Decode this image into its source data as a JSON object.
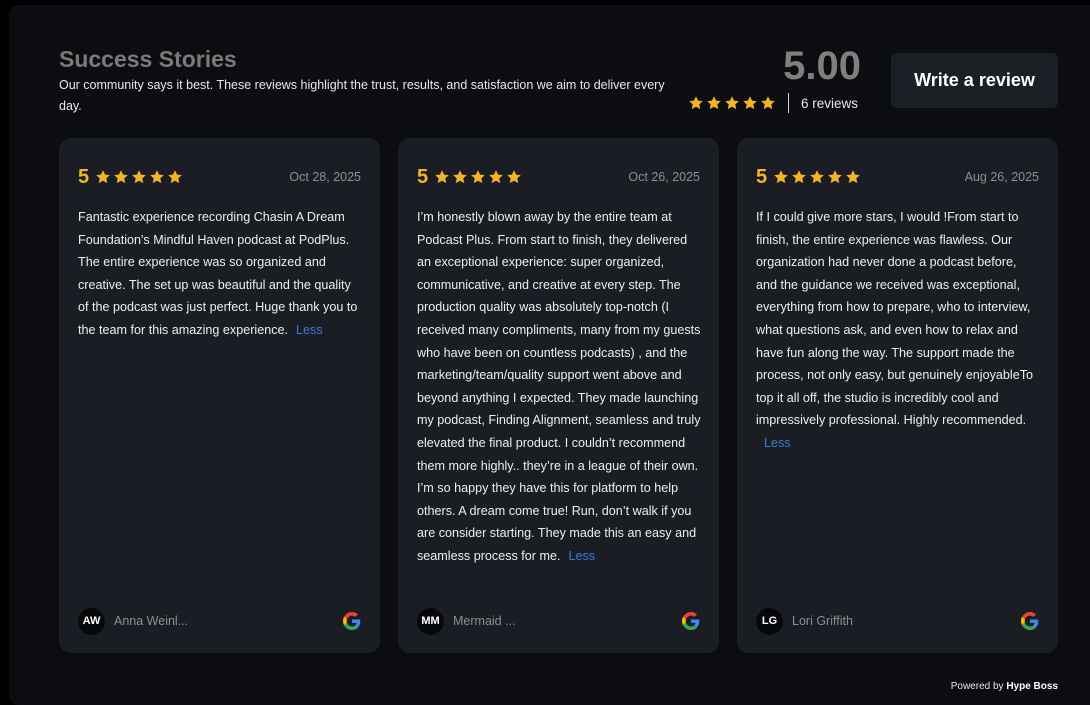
{
  "header": {
    "title": "Success Stories",
    "subtitle": "Our community says it best. These reviews highlight the trust, results, and satisfaction we aim to deliver every day."
  },
  "summary": {
    "score": "5.00",
    "rating": 5,
    "review_count": "6 reviews",
    "write_review_label": "Write a review"
  },
  "colors": {
    "star": "#f5b428",
    "link": "#3a7bd5",
    "card_bg": "#1a1e24"
  },
  "icons": {
    "star": "star-icon",
    "source": "google-icon"
  },
  "reviews": [
    {
      "rating": "5",
      "date": "Oct 28, 2025",
      "text": "Fantastic experience recording Chasin A Dream Foundation's Mindful Haven podcast at PodPlus. The entire experience was so organized and creative. The set up was beautiful and the quality of the podcast was just perfect. Huge thank you to the team for this amazing experience.",
      "less_label": "Less",
      "initials": "AW",
      "author": "Anna Weinl..."
    },
    {
      "rating": "5",
      "date": "Oct 26, 2025",
      "text": "I’m honestly blown away by the entire team at Podcast Plus. From start to finish, they delivered an exceptional experience: super organized, communicative, and creative at every step. The production quality was absolutely top-notch (I received many compliments, many from my guests who have been on countless podcasts) , and the marketing/team/quality support went above and beyond anything I expected. They made launching my podcast, Finding Alignment, seamless and truly elevated the final product. I couldn’t recommend them more highly.. they’re in a league of their own. I’m so happy they have this for platform to help others. A dream come true! Run, don’t walk if you are consider starting. They made this an easy and seamless process for me.",
      "less_label": "Less",
      "initials": "MM",
      "author": "Mermaid ..."
    },
    {
      "rating": "5",
      "date": "Aug 26, 2025",
      "text": "If I could give more stars, I would !From start to finish, the entire experience was flawless. Our organization had never done a podcast before, and the guidance we received was exceptional, everything from how to prepare, who to interview, what questions ask, and even how to relax and have fun along the way. The support made the process, not only easy, but genuinely enjoyableTo top it all off, the studio is incredibly cool and impressively professional. Highly recommended.",
      "less_label": "Less",
      "initials": "LG",
      "author": "Lori Griffith"
    }
  ],
  "footer": {
    "powered_prefix": "Powered by",
    "brand": "Hype Boss"
  }
}
